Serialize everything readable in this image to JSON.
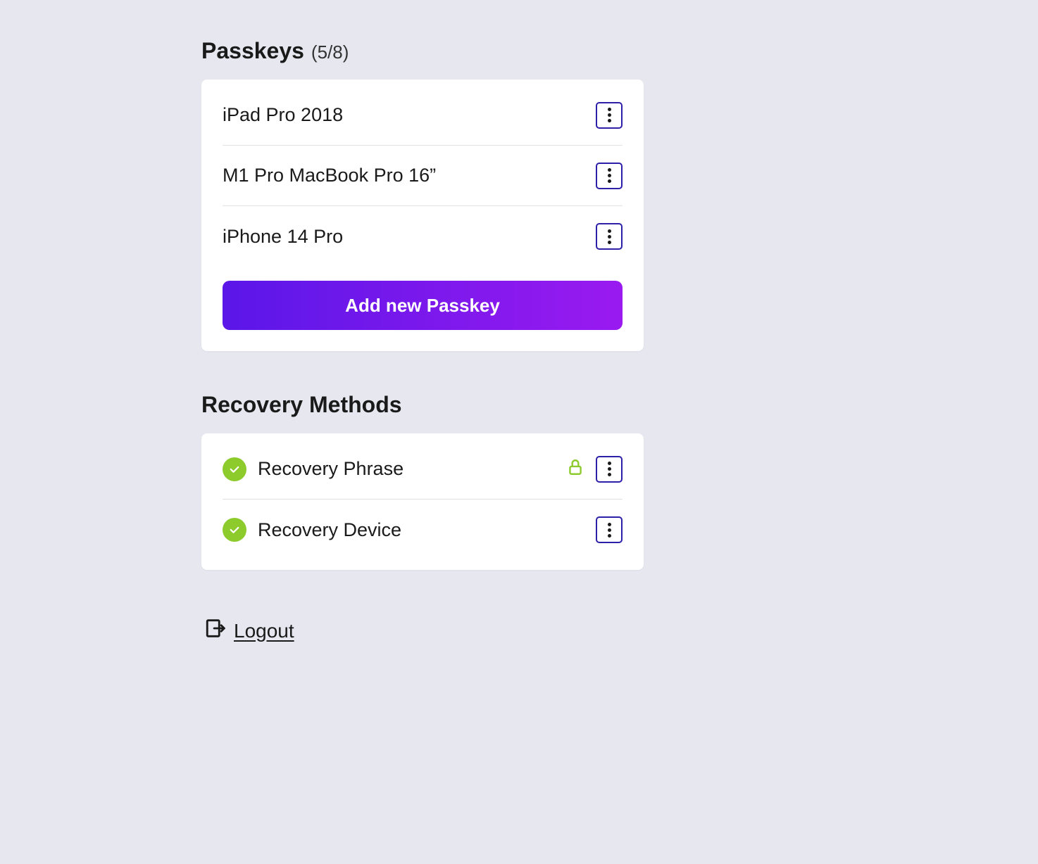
{
  "passkeys": {
    "title": "Passkeys",
    "count": "(5/8)",
    "items": [
      {
        "label": "iPad Pro 2018"
      },
      {
        "label": "M1 Pro MacBook Pro 16”"
      },
      {
        "label": "iPhone 14 Pro"
      }
    ],
    "add_button": "Add new Passkey"
  },
  "recovery": {
    "title": "Recovery Methods",
    "items": [
      {
        "label": "Recovery Phrase",
        "locked": true
      },
      {
        "label": "Recovery Device",
        "locked": false
      }
    ]
  },
  "logout": {
    "label": " Logout"
  }
}
